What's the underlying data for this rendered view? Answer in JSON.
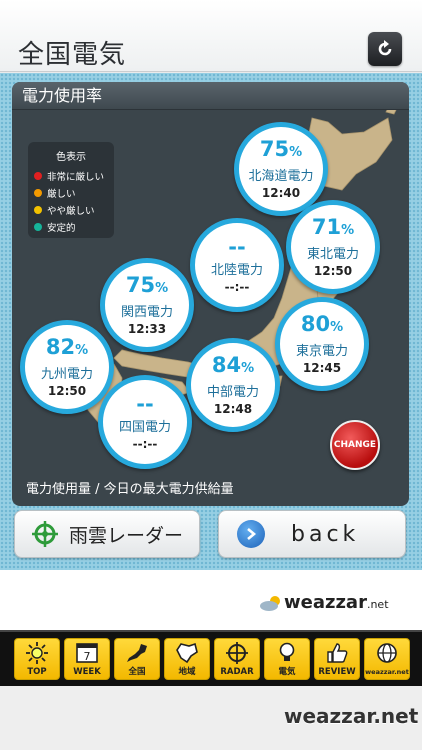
{
  "header": {
    "title": "全国電気",
    "refresh_icon": "refresh-icon"
  },
  "panel": {
    "title": "電力使用率",
    "caption": "電力使用量 / 今日の最大電力供給量"
  },
  "legend": {
    "title": "色表示",
    "items": [
      {
        "label": "非常に厳しい",
        "color": "#e02020"
      },
      {
        "label": "厳しい",
        "color": "#f39a00"
      },
      {
        "label": "やや厳しい",
        "color": "#f2c200"
      },
      {
        "label": "安定的",
        "color": "#16b49a"
      }
    ]
  },
  "regions": [
    {
      "pct": "75",
      "name": "北海道電力",
      "time": "12:40"
    },
    {
      "pct": "71",
      "name": "東北電力",
      "time": "12:50"
    },
    {
      "pct": "--",
      "name": "北陸電力",
      "time": "--:--"
    },
    {
      "pct": "75",
      "name": "関西電力",
      "time": "12:33"
    },
    {
      "pct": "80",
      "name": "東京電力",
      "time": "12:45"
    },
    {
      "pct": "82",
      "name": "九州電力",
      "time": "12:50"
    },
    {
      "pct": "84",
      "name": "中部電力",
      "time": "12:48"
    },
    {
      "pct": "--",
      "name": "四国電力",
      "time": "--:--"
    }
  ],
  "percent_unit": "%",
  "change_button": "CHANGE",
  "buttons": {
    "rain_radar": "雨雲レーダー",
    "back": "back"
  },
  "ad": {
    "brand": "weazzar",
    "suffix": ".net"
  },
  "tabs": [
    {
      "label": "TOP",
      "icon": "sun-icon"
    },
    {
      "label": "WEEK",
      "icon": "calendar-icon",
      "badge": "7"
    },
    {
      "label": "全国",
      "icon": "japan-map-icon"
    },
    {
      "label": "地域",
      "icon": "region-map-icon"
    },
    {
      "label": "RADAR",
      "icon": "radar-icon"
    },
    {
      "label": "電気",
      "icon": "lightbulb-icon"
    },
    {
      "label": "REVIEW",
      "icon": "thumbs-up-icon"
    },
    {
      "label": "weazzar.net",
      "icon": "globe-icon"
    }
  ],
  "footer": {
    "brand": "weazzar.net"
  }
}
